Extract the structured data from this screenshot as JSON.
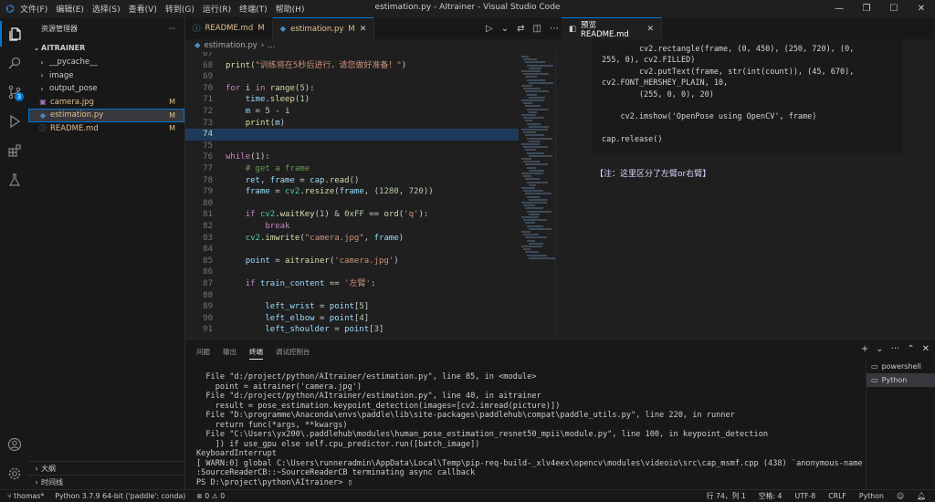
{
  "titlebar": {
    "logo": "⌬",
    "menus": [
      "文件(F)",
      "编辑(E)",
      "选择(S)",
      "查看(V)",
      "转到(G)",
      "运行(R)",
      "终端(T)",
      "帮助(H)"
    ],
    "title": "estimation.py - AItrainer - Visual Studio Code",
    "controls": [
      "—",
      "❐",
      "☐",
      "✕"
    ]
  },
  "activity": {
    "scm_badge": "3"
  },
  "sidebar": {
    "header": "资源管理器",
    "header_more": "···",
    "section": "AITRAINER",
    "items": [
      {
        "label": "__pycache__",
        "type": "folder",
        "mark": ""
      },
      {
        "label": "image",
        "type": "folder",
        "mark": ""
      },
      {
        "label": "output_pose",
        "type": "folder",
        "mark": ""
      },
      {
        "label": "camera.jpg",
        "type": "image",
        "mark": "M"
      },
      {
        "label": "estimation.py",
        "type": "python",
        "mark": "M"
      },
      {
        "label": "README.md",
        "type": "markdown",
        "mark": "M"
      }
    ],
    "outline": "大纲",
    "timeline": "时间线"
  },
  "tabs": [
    {
      "label": "README.md",
      "mark": "M"
    },
    {
      "label": "estimation.py",
      "mark": "M",
      "close": "✕"
    }
  ],
  "breadcrumb": [
    "estimation.py",
    "..."
  ],
  "code": [
    {
      "n": "67",
      "html": ""
    },
    {
      "n": "68",
      "html": "<span class='fn'>print</span>(<span class='str'>\"训练将在5秒后进行，请您做好准备！\"</span>)"
    },
    {
      "n": "69",
      "html": ""
    },
    {
      "n": "70",
      "html": "<span class='kw'>for</span> <span class='var'>i</span> <span class='kw'>in</span> <span class='fn'>range</span>(<span class='num'>5</span>):"
    },
    {
      "n": "71",
      "html": "    <span class='var'>time</span>.<span class='fn'>sleep</span>(<span class='num'>1</span>)"
    },
    {
      "n": "72",
      "html": "    <span class='var'>m</span> = <span class='num'>5</span> - <span class='var'>i</span>"
    },
    {
      "n": "73",
      "html": "    <span class='fn'>print</span>(<span class='var'>m</span>)"
    },
    {
      "n": "74",
      "html": "",
      "current": true
    },
    {
      "n": "75",
      "html": ""
    },
    {
      "n": "76",
      "html": "<span class='kw'>while</span>(<span class='num'>1</span>):"
    },
    {
      "n": "77",
      "html": "    <span class='cm'># get a frame</span>"
    },
    {
      "n": "78",
      "html": "    <span class='var'>ret</span>, <span class='var'>frame</span> = <span class='var'>cap</span>.<span class='fn'>read</span>()"
    },
    {
      "n": "79",
      "html": "    <span class='var'>frame</span> = <span class='bi'>cv2</span>.<span class='fn'>resize</span>(<span class='var'>frame</span>, (<span class='num'>1280</span>, <span class='num'>720</span>))"
    },
    {
      "n": "80",
      "html": ""
    },
    {
      "n": "81",
      "html": "    <span class='kw'>if</span> <span class='bi'>cv2</span>.<span class='fn'>waitKey</span>(<span class='num'>1</span>) &amp; <span class='num'>0xFF</span> == <span class='fn'>ord</span>(<span class='str'>'q'</span>):"
    },
    {
      "n": "82",
      "html": "        <span class='kw'>break</span>"
    },
    {
      "n": "83",
      "html": "    <span class='bi'>cv2</span>.<span class='fn'>imwrite</span>(<span class='str'>\"camera.jpg\"</span>, <span class='var'>frame</span>)"
    },
    {
      "n": "84",
      "html": ""
    },
    {
      "n": "85",
      "html": "    <span class='var'>point</span> = <span class='fn'>aitrainer</span>(<span class='str'>'camera.jpg'</span>)"
    },
    {
      "n": "86",
      "html": ""
    },
    {
      "n": "87",
      "html": "    <span class='kw'>if</span> <span class='var'>train_content</span> == <span class='str'>'左臂'</span>:"
    },
    {
      "n": "88",
      "html": ""
    },
    {
      "n": "89",
      "html": "        <span class='var'>left_wrist</span> = <span class='var'>point</span>[<span class='num'>5</span>]"
    },
    {
      "n": "90",
      "html": "        <span class='var'>left_elbow</span> = <span class='var'>point</span>[<span class='num'>4</span>]"
    },
    {
      "n": "91",
      "html": "        <span class='var'>left_shoulder</span> = <span class='var'>point</span>[<span class='num'>3</span>]"
    }
  ],
  "preview": {
    "tab_label": "预览 README.md",
    "tab_close": "✕",
    "lines": [
      "        cv2.rectangle(frame, (0, 450), (250, 720), (0,",
      "255, 0), cv2.FILLED)",
      "        cv2.putText(frame, str(int(count)), (45, 670),",
      "cv2.FONT_HERSHEY_PLAIN, 10,",
      "        (255, 0, 0), 20)",
      "",
      "    cv2.imshow('OpenPose using OpenCV', frame)",
      "",
      "cap.release()"
    ],
    "note": "【注：这里区分了左臂or右臂】"
  },
  "panel": {
    "tabs": [
      "问题",
      "输出",
      "终端",
      "调试控制台"
    ],
    "active_tab": 2,
    "actions": [
      "+",
      "⌄",
      "···",
      "⌃",
      "✕"
    ],
    "terminal": [
      "  File \"d:/project/python/AItrainer/estimation.py\", line 85, in <module>",
      "    point = aitrainer('camera.jpg')",
      "  File \"d:/project/python/AItrainer/estimation.py\", line 40, in aitrainer",
      "    result = pose_estimation.keypoint_detection(images=[cv2.imread(picture)])",
      "  File \"D:\\programme\\Anaconda\\envs\\paddle\\lib\\site-packages\\paddlehub\\compat\\paddle_utils.py\", line 220, in runner",
      "    return func(*args, **kwargs)",
      "  File \"C:\\Users\\yx200\\.paddlehub\\modules\\human_pose_estimation_resnet50_mpii\\module.py\", line 100, in keypoint_detection",
      "    ]) if use_gpu else self.cpu_predictor.run([batch_image])",
      "KeyboardInterrupt",
      "[ WARN:0] global C:\\Users\\runneradmin\\AppData\\Local\\Temp\\pip-req-build-_xlv4eex\\opencv\\modules\\videoio\\src\\cap_msmf.cpp (438) `anonymous-namespace':",
      ":SourceReaderCB::~SourceReaderCB terminating async callback",
      "PS D:\\project\\python\\AItrainer> ▯"
    ],
    "terminals": [
      "powershell",
      "Python"
    ]
  },
  "status": {
    "branch": "thomas*",
    "interpreter": "Python 3.7.9 64-bit ('paddle': conda)",
    "problems": "⊗ 0  ⚠ 0",
    "position": "行 74，列 1",
    "spaces": "空格: 4",
    "encoding": "UTF-8",
    "eol": "CRLF",
    "language": "Python"
  }
}
